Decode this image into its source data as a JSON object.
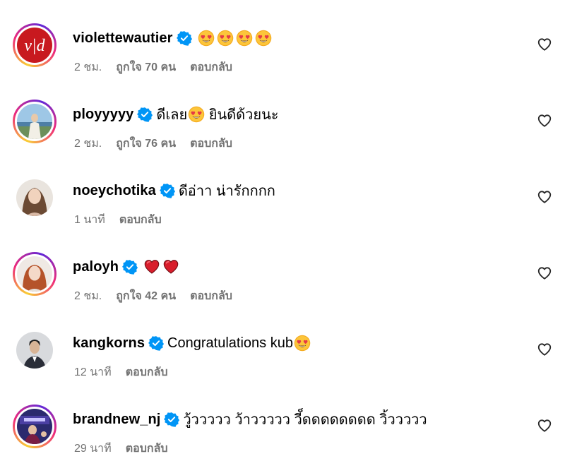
{
  "comments": [
    {
      "username": "violettewautier",
      "text": "",
      "emojis": [
        "heart-eyes",
        "heart-eyes",
        "heart-eyes",
        "heart-eyes"
      ],
      "time": "2 ชม.",
      "likes": "ถูกใจ 70 คน",
      "reply": "ตอบกลับ",
      "story_ring": true
    },
    {
      "username": "ployyyyy",
      "text_before": "ดีเลย",
      "emojis": [
        "heart-eyes"
      ],
      "text_after": " ยินดีด้วยนะ",
      "time": "2 ชม.",
      "likes": "ถูกใจ 76 คน",
      "reply": "ตอบกลับ",
      "story_ring": true
    },
    {
      "username": "noeychotika",
      "text": "ดีอ่าา น่ารักกกก",
      "time": "1 นาที",
      "reply": "ตอบกลับ",
      "story_ring": false
    },
    {
      "username": "paloyh",
      "text": "",
      "emojis": [
        "red-heart",
        "red-heart"
      ],
      "time": "2 ชม.",
      "likes": "ถูกใจ 42 คน",
      "reply": "ตอบกลับ",
      "story_ring": true
    },
    {
      "username": "kangkorns",
      "text": "Congratulations kub",
      "emojis": [
        "heart-eyes"
      ],
      "time": "12 นาที",
      "reply": "ตอบกลับ",
      "story_ring": false
    },
    {
      "username": "brandnew_nj",
      "text": "วู้ววววว ว้าววววว วี็ดดดดดดดด วิ้ววววว",
      "time": "29 นาที",
      "reply": "ตอบกลับ",
      "story_ring": true
    }
  ],
  "colors": {
    "verified_blue": "#0095f6",
    "meta_gray": "#737373",
    "text": "#000000"
  },
  "icons": [
    "verified-badge-icon",
    "heart-outline-icon",
    "heart-eyes-emoji",
    "red-heart-emoji"
  ]
}
